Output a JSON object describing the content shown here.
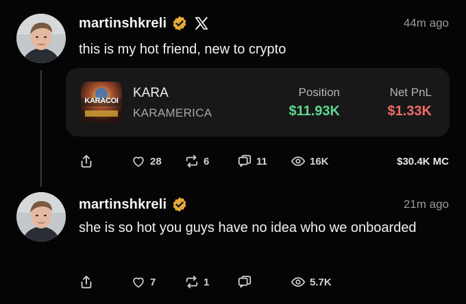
{
  "posts": [
    {
      "username": "martinshkreli",
      "time": "44m ago",
      "text": "this is my hot friend, new to crypto",
      "card": {
        "ticker": "KARA",
        "name": "KARAMERICA",
        "image_text": "KARACOI",
        "position_label": "Position",
        "position_value": "$11.93K",
        "pnl_label": "Net PnL",
        "pnl_value": "$1.33K"
      },
      "likes": "28",
      "reposts": "6",
      "quotes": "11",
      "views": "16K",
      "market_cap": "$30.4K MC"
    },
    {
      "username": "martinshkreli",
      "time": "21m ago",
      "text": "she is so hot you guys have no idea who we onboarded",
      "likes": "7",
      "reposts": "1",
      "views": "5.7K"
    }
  ],
  "colors": {
    "background": "#050505",
    "card": "#181818",
    "verified_badge": "#e8a93a",
    "positive": "#5fd78c",
    "negative": "#f06b6b",
    "muted": "#9a9a9a"
  },
  "icons": [
    "share-icon",
    "heart-icon",
    "repost-icon",
    "quote-icon",
    "views-icon",
    "verified-badge-icon",
    "x-logo-icon"
  ]
}
